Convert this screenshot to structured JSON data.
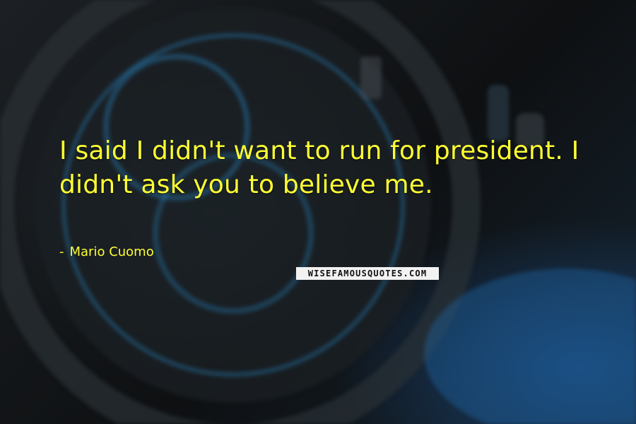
{
  "quote": {
    "text": "I said I didn't want to run for president. I didn't ask you to believe me.",
    "author": "Mario Cuomo",
    "dash": "-"
  },
  "watermark": {
    "text": "WISEFAMOUSQUOTES.COM"
  },
  "colors": {
    "text": "#ffff33",
    "background": "#141618",
    "accent_blue": "#2a8fd0"
  }
}
